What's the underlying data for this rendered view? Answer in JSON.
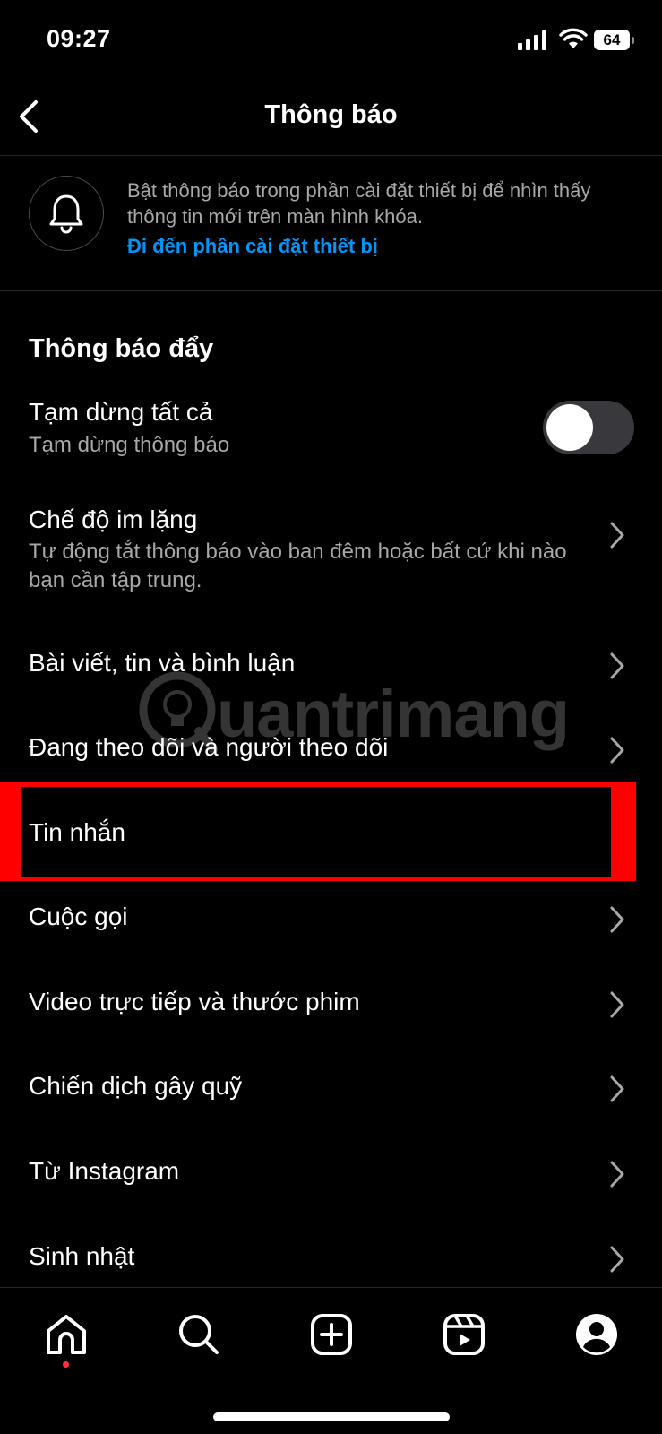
{
  "status_bar": {
    "time": "09:27",
    "battery": "64"
  },
  "header": {
    "title": "Thông báo"
  },
  "banner": {
    "text": "Bật thông báo trong phần cài đặt thiết bị để nhìn thấy thông tin mới trên màn hình khóa.",
    "link": "Đi đến phần cài đặt thiết bị"
  },
  "section": {
    "title": "Thông báo đẩy"
  },
  "rows": [
    {
      "title": "Tạm dừng tất cả",
      "subtitle": "Tạm dừng thông báo",
      "control": "toggle",
      "toggle_on": false
    },
    {
      "title": "Chế độ im lặng",
      "subtitle": "Tự động tắt thông báo vào ban đêm hoặc bất cứ khi nào bạn cần tập trung.",
      "control": "chevron"
    },
    {
      "title": "Bài viết, tin và bình luận",
      "control": "chevron"
    },
    {
      "title": "Đang theo dõi và người theo dõi",
      "control": "chevron"
    },
    {
      "title": "Tin nhắn",
      "control": "chevron",
      "highlighted": true
    },
    {
      "title": "Cuộc gọi",
      "control": "chevron"
    },
    {
      "title": "Video trực tiếp và thước phim",
      "control": "chevron"
    },
    {
      "title": "Chiến dịch gây quỹ",
      "control": "chevron"
    },
    {
      "title": "Từ Instagram",
      "control": "chevron"
    },
    {
      "title": "Sinh nhật",
      "control": "chevron"
    }
  ],
  "watermark": {
    "text": "uantrimang"
  },
  "bottom_nav": [
    {
      "icon": "home-icon",
      "active": true
    },
    {
      "icon": "search-icon"
    },
    {
      "icon": "create-icon"
    },
    {
      "icon": "reels-icon"
    },
    {
      "icon": "profile-icon"
    }
  ],
  "colors": {
    "background": "#000000",
    "link": "#0095f6",
    "secondary_text": "#a8a8a8",
    "highlight": "#ff0000",
    "notification_dot": "#ff3040"
  }
}
